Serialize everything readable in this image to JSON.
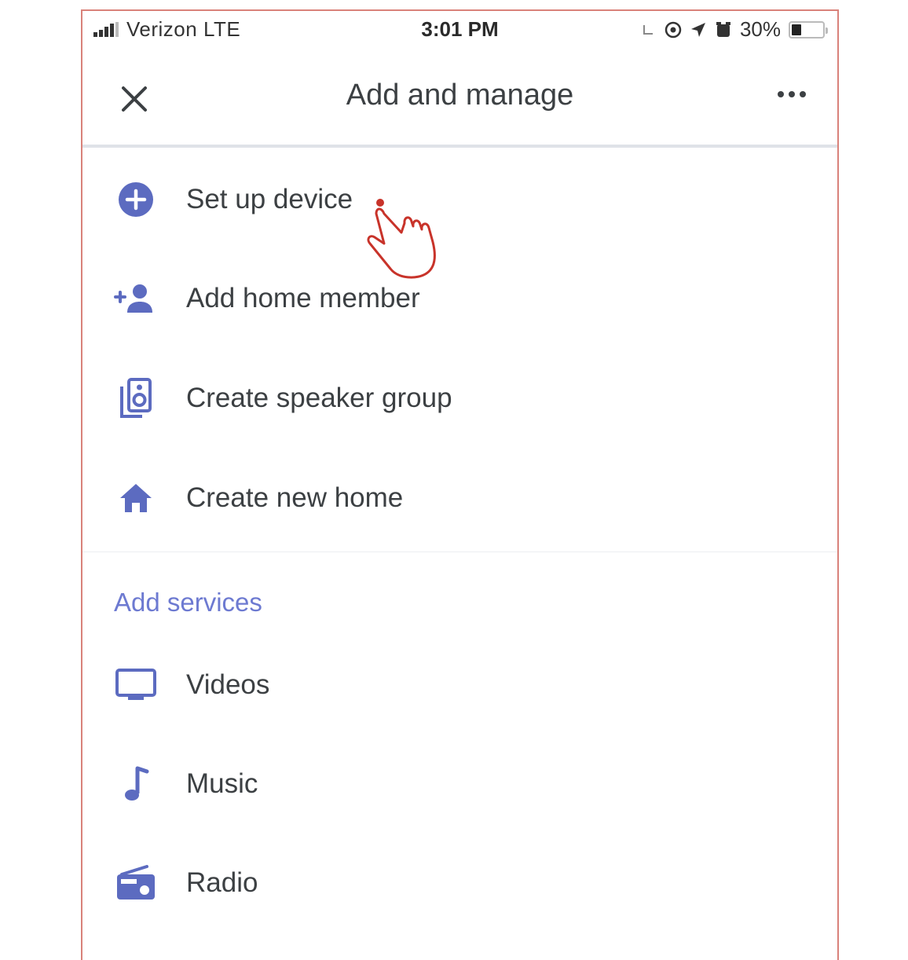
{
  "status_bar": {
    "carrier": "Verizon  LTE",
    "time": "3:01 PM",
    "battery": "30%"
  },
  "header": {
    "title": "Add and manage"
  },
  "menu": {
    "items": [
      {
        "label": "Set up device",
        "icon": "add-circle-icon"
      },
      {
        "label": "Add home member",
        "icon": "add-person-icon"
      },
      {
        "label": "Create speaker group",
        "icon": "speaker-group-icon"
      },
      {
        "label": "Create new home",
        "icon": "home-icon"
      }
    ]
  },
  "services": {
    "title": "Add services",
    "items": [
      {
        "label": "Videos",
        "icon": "tv-icon"
      },
      {
        "label": "Music",
        "icon": "music-note-icon"
      },
      {
        "label": "Radio",
        "icon": "radio-icon"
      }
    ]
  },
  "colors": {
    "accent": "#5c6bc0",
    "section_title": "#6d7ad1",
    "text": "#3c4043",
    "frame_border": "#d9827a"
  }
}
